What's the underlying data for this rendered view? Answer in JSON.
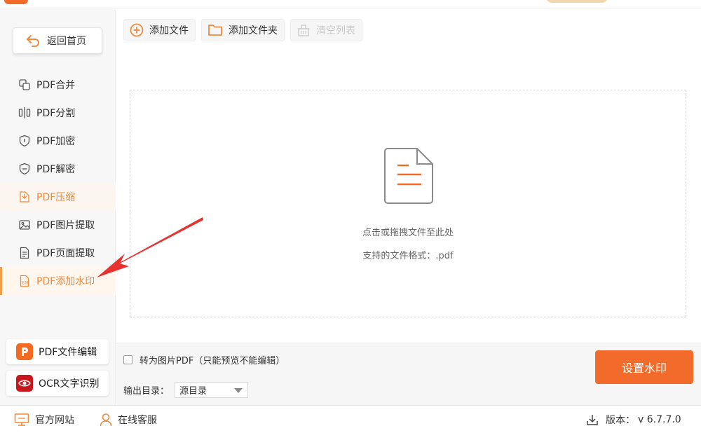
{
  "sidebar": {
    "home_label": "返回首页",
    "items": [
      {
        "label": "PDF合并",
        "icon": "merge-icon",
        "state": "normal"
      },
      {
        "label": "PDF分割",
        "icon": "split-icon",
        "state": "normal"
      },
      {
        "label": "PDF加密",
        "icon": "shield-lock-icon",
        "state": "normal"
      },
      {
        "label": "PDF解密",
        "icon": "shield-unlock-icon",
        "state": "normal"
      },
      {
        "label": "PDF压缩",
        "icon": "compress-icon",
        "state": "hover"
      },
      {
        "label": "PDF图片提取",
        "icon": "image-icon",
        "state": "normal"
      },
      {
        "label": "PDF页面提取",
        "icon": "page-icon",
        "state": "normal"
      },
      {
        "label": "PDF添加水印",
        "icon": "watermark-icon",
        "state": "active"
      }
    ],
    "tools": [
      {
        "label": "PDF文件编辑",
        "icon": "pdf-editor-icon"
      },
      {
        "label": "OCR文字识别",
        "icon": "ocr-eye-icon"
      }
    ]
  },
  "toolbar": {
    "add_file": "添加文件",
    "add_folder": "添加文件夹",
    "clear_list": "清空列表"
  },
  "dropzone": {
    "line1": "点击或拖拽文件至此处",
    "line2": "支持的文件格式：.pdf"
  },
  "options": {
    "convert_label": "转为图片PDF（只能预览不能编辑）",
    "convert_checked": false,
    "output_label": "输出目录：",
    "output_value": "源目录",
    "action_label": "设置水印"
  },
  "status": {
    "website": "官方网站",
    "support": "在线客服",
    "version_label": "版本：",
    "version_value": "v 6.7.7.0"
  },
  "colors": {
    "accent": "#f26b2a",
    "active_text": "#f08a3c",
    "annotation_arrow": "#e8322f"
  }
}
